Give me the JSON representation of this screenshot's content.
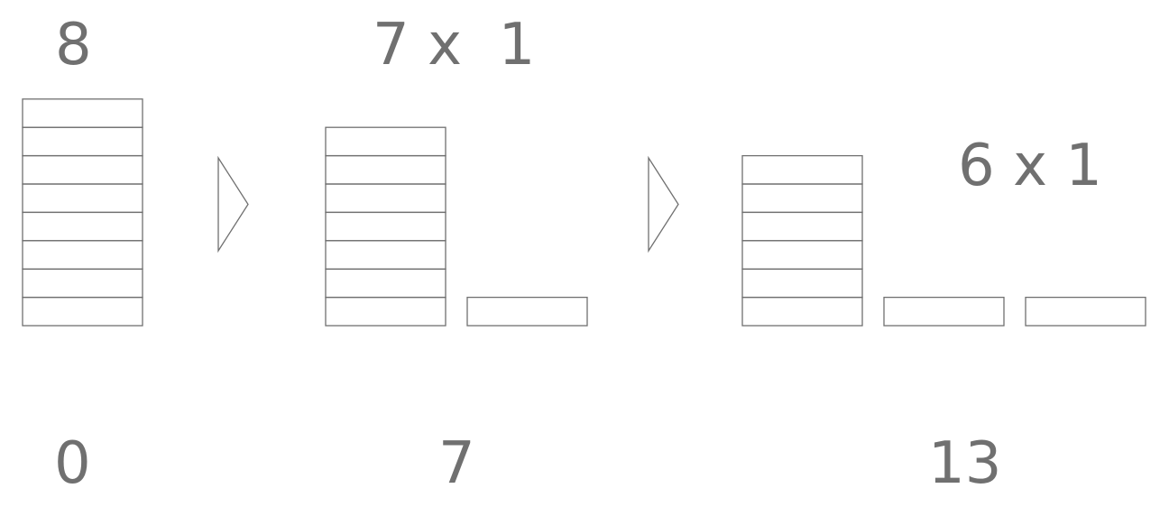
{
  "colors": {
    "stroke": "#707070",
    "text": "#707070",
    "background": "#ffffff"
  },
  "stages": [
    {
      "top_label": "8",
      "bottom_label": "0",
      "stack_count": 8,
      "single_bars": 0
    },
    {
      "top_label": "7 x  1",
      "bottom_label": "7",
      "stack_count": 7,
      "single_bars": 1
    },
    {
      "top_label": "6 x 1",
      "bottom_label": "13",
      "stack_count": 6,
      "single_bars": 2
    }
  ],
  "arrows": [
    {
      "icon": "triangle-right-arrow-icon"
    },
    {
      "icon": "triangle-right-arrow-icon"
    }
  ]
}
